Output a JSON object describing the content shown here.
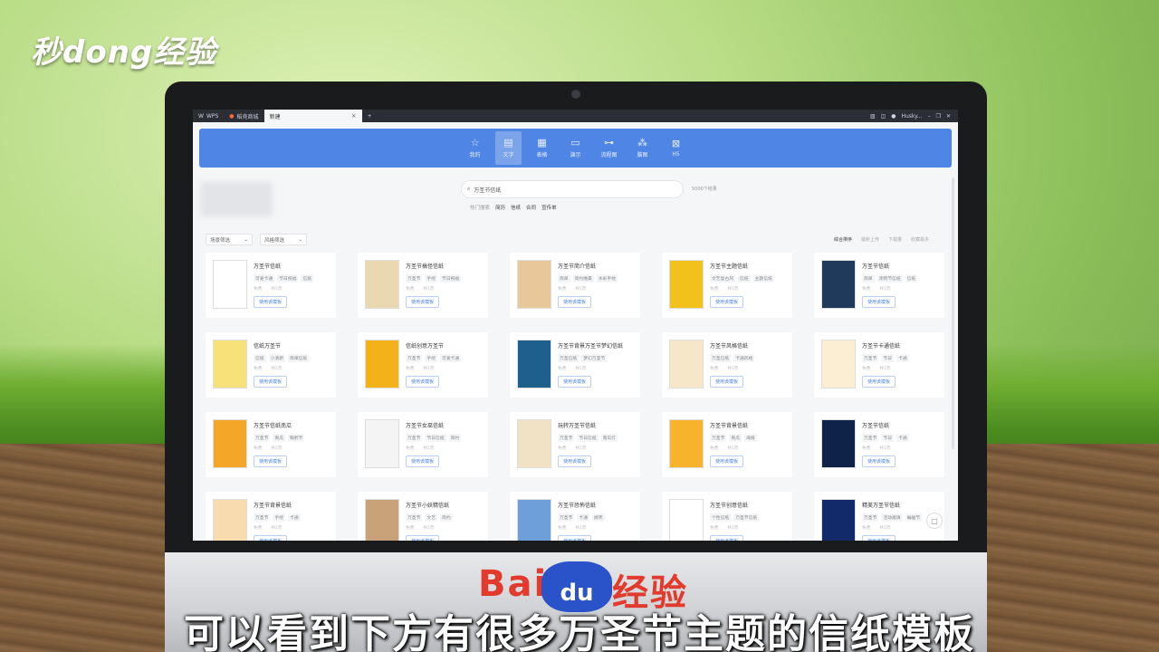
{
  "overlay": {
    "brand": "秒dong经验",
    "baidu_text": "Bai",
    "baidu_paw": "du",
    "baidu_suffix": "经验",
    "caption": "可以看到下方有很多万圣节主题的信纸模板"
  },
  "tabs": [
    {
      "label": "WPS"
    },
    {
      "label": "稻壳商城"
    },
    {
      "label": "新建",
      "active": true
    }
  ],
  "tab_close": "×",
  "tab_add": "+",
  "user_name": "Husky...",
  "nav": [
    {
      "label": "我的",
      "icon": "star-icon",
      "glyph": "☆"
    },
    {
      "label": "文字",
      "icon": "document-icon",
      "glyph": "▤",
      "active": true
    },
    {
      "label": "表格",
      "icon": "table-icon",
      "glyph": "▦"
    },
    {
      "label": "演示",
      "icon": "presentation-icon",
      "glyph": "▭"
    },
    {
      "label": "流程图",
      "icon": "flowchart-icon",
      "glyph": "⊶"
    },
    {
      "label": "脑图",
      "icon": "mindmap-icon",
      "glyph": "⁂"
    },
    {
      "label": "H5",
      "icon": "h5-icon",
      "glyph": "⊠"
    }
  ],
  "search": {
    "value": "万圣节信纸",
    "result_count": "5000个结果"
  },
  "hot": {
    "label": "热门搜索",
    "items": [
      "简历",
      "信纸",
      "合同",
      "宣传单"
    ]
  },
  "filters": [
    "场景筛选",
    "风格筛选"
  ],
  "sorts": [
    "综合排序",
    "最新上传",
    "下载量",
    "收藏最多"
  ],
  "use_label": "使用该模板",
  "meta": {
    "free": "免费",
    "pages": "共1页"
  },
  "cards": [
    {
      "title": "万圣节信纸",
      "tags": [
        "可爱卡通",
        "节日祝福",
        "信纸"
      ],
      "thumb": "#ffffff"
    },
    {
      "title": "万圣节搞怪信纸",
      "tags": [
        "万圣节",
        "手绘",
        "节日祝福"
      ],
      "thumb": "#ead8b0"
    },
    {
      "title": "万圣节简介信纸",
      "tags": [
        "简单",
        "简约唯美",
        "水彩手绘"
      ],
      "thumb": "#e8c79a"
    },
    {
      "title": "万圣节主题信纸",
      "tags": [
        "文艺复古风",
        "信纸",
        "主题信纸"
      ],
      "thumb": "#f2c21c"
    },
    {
      "title": "万圣节信纸",
      "tags": [
        "简单",
        "涂鸦节信纸",
        "信纸"
      ],
      "thumb": "#1f3a5a"
    },
    {
      "title": "信纸万圣节",
      "tags": [
        "信纸",
        "小清新",
        "简单信纸"
      ],
      "thumb": "#f7e27a"
    },
    {
      "title": "信纸创意万圣节",
      "tags": [
        "万圣节",
        "手绘",
        "可爱卡通"
      ],
      "thumb": "#f3b21a"
    },
    {
      "title": "万圣节背景万圣节梦幻信纸",
      "tags": [
        "万圣信纸",
        "梦幻万圣节"
      ],
      "thumb": "#1e5f8e"
    },
    {
      "title": "万圣节风格信纸",
      "tags": [
        "万圣信纸",
        "卡通风格"
      ],
      "thumb": "#f6e7c8"
    },
    {
      "title": "万圣节卡通信纸",
      "tags": [
        "万圣节",
        "节日",
        "卡通"
      ],
      "thumb": "#fbeed2"
    },
    {
      "title": "万圣节信纸南瓜",
      "tags": [
        "万圣节",
        "南瓜",
        "鞠躬节"
      ],
      "thumb": "#f3a628"
    },
    {
      "title": "万圣节女巫信纸",
      "tags": [
        "万圣节",
        "节日信纸",
        "简约"
      ],
      "thumb": "#f4f4f4"
    },
    {
      "title": "玩转万圣节信纸",
      "tags": [
        "万圣节",
        "节日信纸",
        "南瓜灯"
      ],
      "thumb": "#f1e2c6"
    },
    {
      "title": "万圣节背景信纸",
      "tags": [
        "万圣节",
        "南瓜",
        "海报"
      ],
      "thumb": "#f6b32b"
    },
    {
      "title": "万圣节信纸",
      "tags": [
        "万圣节",
        "节日",
        "卡通"
      ],
      "thumb": "#0e2347"
    },
    {
      "title": "万圣节背景信纸",
      "tags": [
        "万圣节",
        "手绘",
        "卡通"
      ],
      "thumb": "#f8dcb0"
    },
    {
      "title": "万圣节小妖精信纸",
      "tags": [
        "万圣节",
        "文艺",
        "简约"
      ],
      "thumb": "#c9a27a"
    },
    {
      "title": "万圣节恐怖信纸",
      "tags": [
        "万圣节",
        "卡通",
        "搞笑"
      ],
      "thumb": "#6f9fd8"
    },
    {
      "title": "万圣节创意信纸",
      "tags": [
        "个性信纸",
        "万圣节信纸"
      ],
      "thumb": "#ffffff"
    },
    {
      "title": "精美万圣节信纸",
      "tags": [
        "万圣节",
        "活动邀请",
        "蝙蝠节"
      ],
      "thumb": "#122a6a"
    }
  ]
}
